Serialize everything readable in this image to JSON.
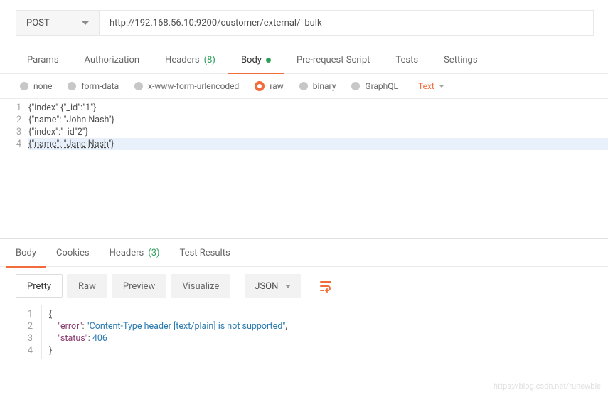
{
  "request": {
    "method": "POST",
    "url": "http://192.168.56.10:9200/customer/external/_bulk"
  },
  "request_tabs": {
    "params": "Params",
    "authorization": "Authorization",
    "headers_label": "Headers",
    "headers_count": "(8)",
    "body": "Body",
    "prerequest": "Pre-request Script",
    "tests": "Tests",
    "settings": "Settings"
  },
  "body_types": {
    "none": "none",
    "formdata": "form-data",
    "xwww": "x-www-form-urlencoded",
    "raw": "raw",
    "binary": "binary",
    "graphql": "GraphQL",
    "text_label": "Text"
  },
  "body_lines": [
    "{\"index\" {\"_id\":\"1\"}",
    "{\"name\": \"John Nash\"}",
    "{\"index\":\"_id\"2\"}",
    "{\"name\": \"Jane Nash\"}"
  ],
  "response_tabs": {
    "body": "Body",
    "cookies": "Cookies",
    "headers_label": "Headers",
    "headers_count": "(3)",
    "testresults": "Test Results"
  },
  "response_toolbar": {
    "pretty": "Pretty",
    "raw": "Raw",
    "preview": "Preview",
    "visualize": "Visualize",
    "format": "JSON"
  },
  "response_json": {
    "error_key": "\"error\"",
    "error_val_pre": "\"Content-Type header [text",
    "error_val_underlined": "/plain]",
    "error_val_post": " is not supported\"",
    "status_key": "\"status\"",
    "status_val": "406"
  },
  "watermark": "https://blog.csdn.net/runewbie"
}
